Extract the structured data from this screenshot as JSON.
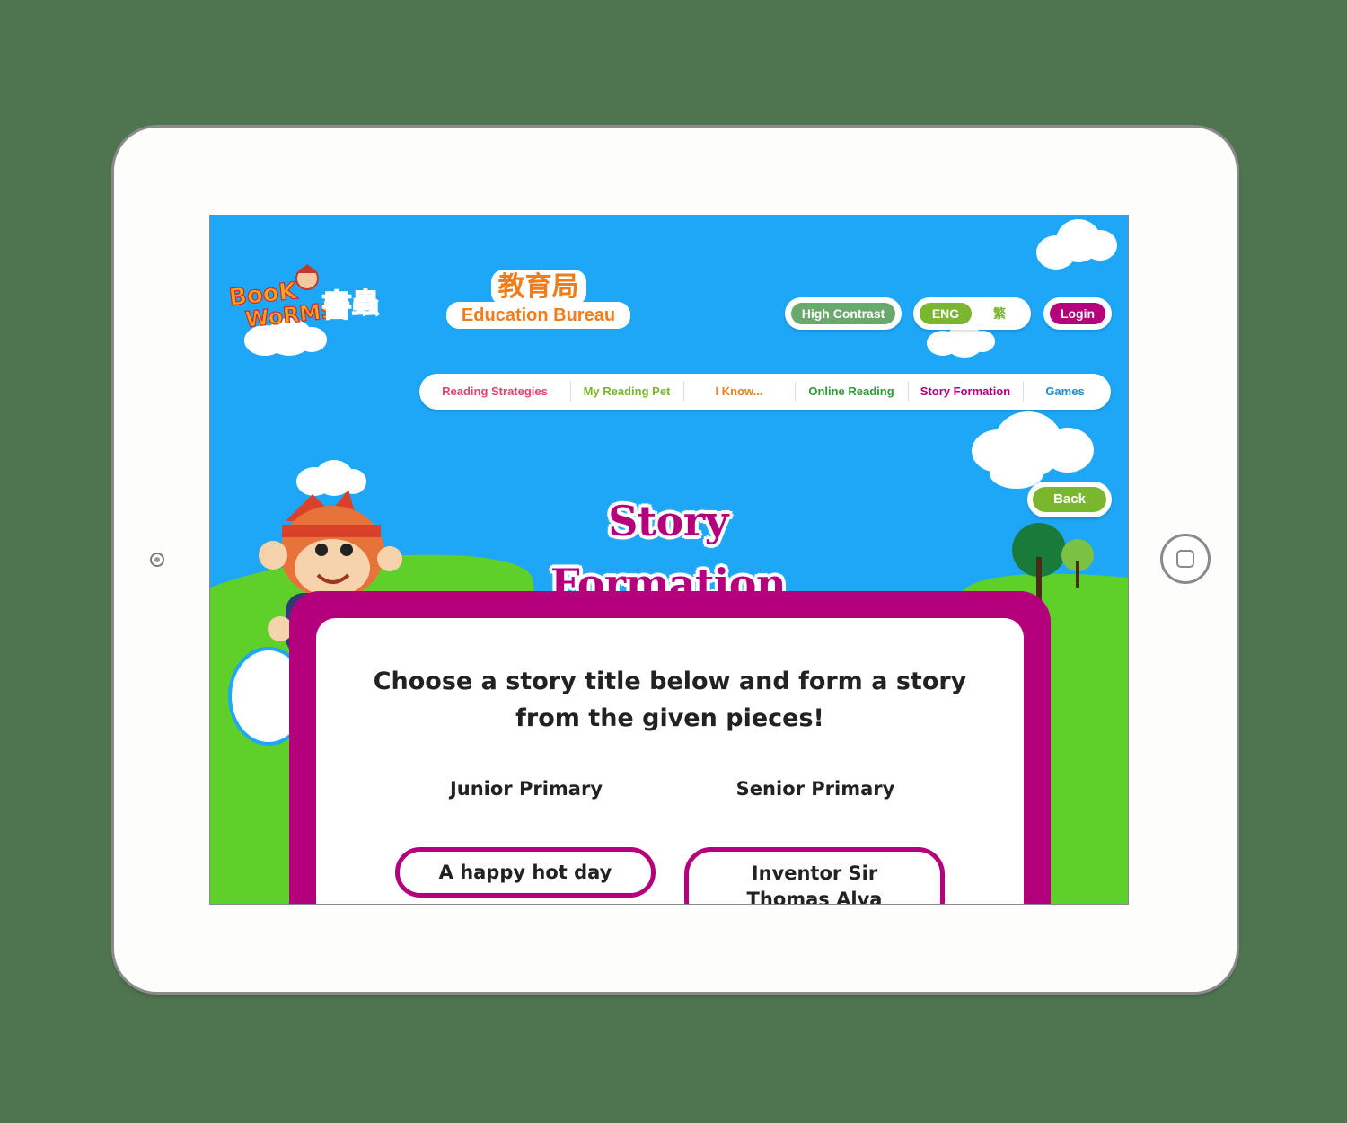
{
  "header": {
    "logo_text": "BookWorms 書蟲",
    "edb_chinese": "教育局",
    "edb_english": "Education Bureau"
  },
  "toolbar": {
    "high_contrast_label": "High Contrast",
    "lang_eng_label": "ENG",
    "lang_chinese_label": "繁",
    "login_label": "Login"
  },
  "nav": {
    "items": [
      {
        "label": "Reading Strategies",
        "color": "#e0466a"
      },
      {
        "label": "My Reading Pet",
        "color": "#7ab62e"
      },
      {
        "label": "I Know...",
        "color": "#f07d1a"
      },
      {
        "label": "Online Reading",
        "color": "#2e9a3a"
      },
      {
        "label": "Story Formation",
        "color": "#b5007c"
      },
      {
        "label": "Games",
        "color": "#1f8fc9"
      }
    ]
  },
  "back_label": "Back",
  "page_title": "Story Formation",
  "main": {
    "instruction": "Choose a story title below and form a story from the given pieces!",
    "categories": [
      {
        "label": "Junior Primary",
        "stories": [
          "A happy hot day"
        ]
      },
      {
        "label": "Senior Primary",
        "stories": [
          "Inventor Sir Thomas Alva Edison"
        ]
      }
    ]
  },
  "colors": {
    "accent": "#b5007c",
    "sky": "#1ea7f7",
    "grass": "#5fcf2a",
    "button_green": "#7ab62e",
    "contrast_green": "#6aa96e"
  }
}
